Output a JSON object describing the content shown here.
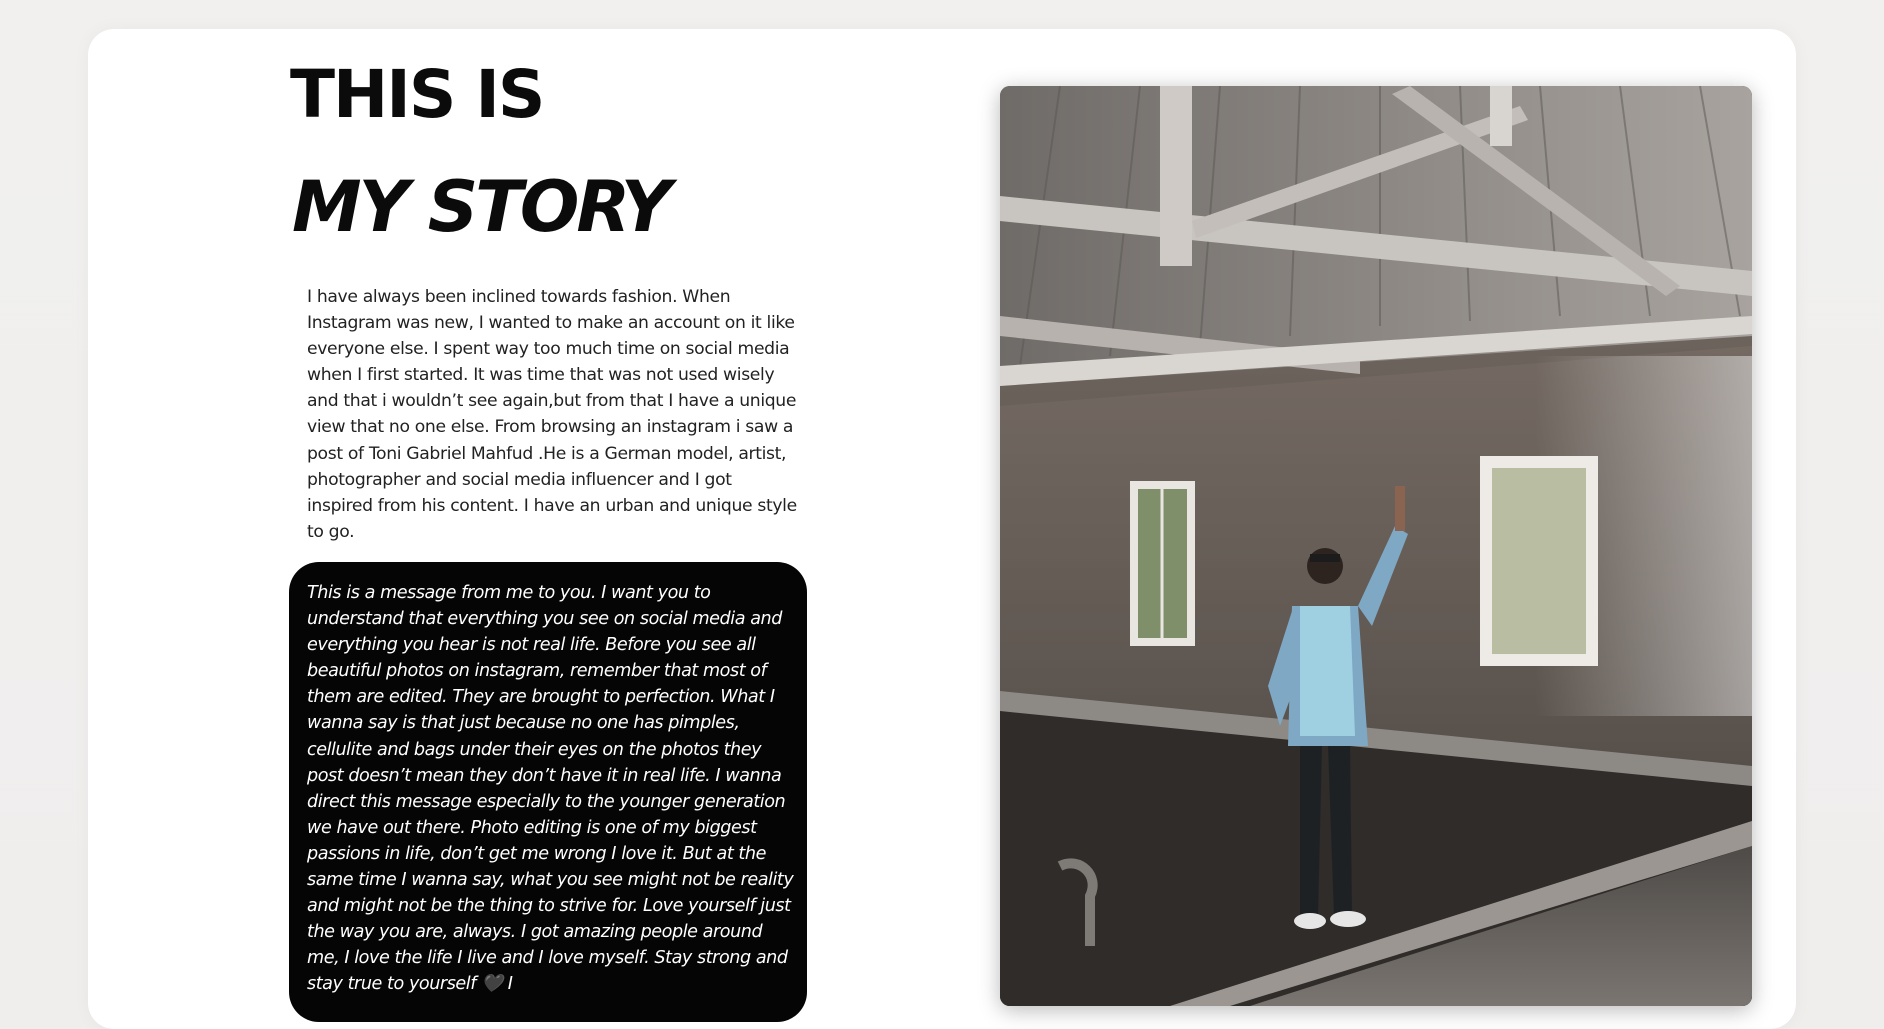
{
  "header": {
    "title_line1": "THIS IS",
    "title_line2": "MY STORY"
  },
  "intro": {
    "text": "I have always been inclined towards fashion. When Instagram was new, I wanted to make an account on it like everyone else. I spent way too much time on social media when I first started. It was time that was not used wisely and that i wouldn’t see again,but from that I have a unique view that no one else. From browsing an instagram i saw a post of Toni Gabriel Mahfud .He is a German model, artist, photographer and social media influencer and I got inspired from his content. I have an urban and unique style to go."
  },
  "message": {
    "text": "This is a message from me to you. I want you to understand that everything you see on social media and everything you hear is not real life. Before you see all beautiful photos on instagram, remember that most of them are edited. They are brought to perfection. What I wanna say is that just because no one has pimples, cellulite and bags under their eyes on the photos they post doesn’t mean they don’t have it in real life. I wanna direct this message especially to the younger generation we have out there. Photo editing is one of my biggest passions in life, don’t get me wrong I love it. But at the same time I wanna say, what you see might not be reality and might not be the thing to strive for. Love yourself just the way you are, always. I got amazing people around me, I love the life I live and I love myself. Stay strong and stay true to yourself 🖤 I"
  },
  "colors": {
    "page_background": "#efeeed",
    "card_background": "#ffffff",
    "title_text": "#0b0b0b",
    "body_text": "#222222",
    "message_background": "#050505",
    "message_text": "#ffffff"
  }
}
